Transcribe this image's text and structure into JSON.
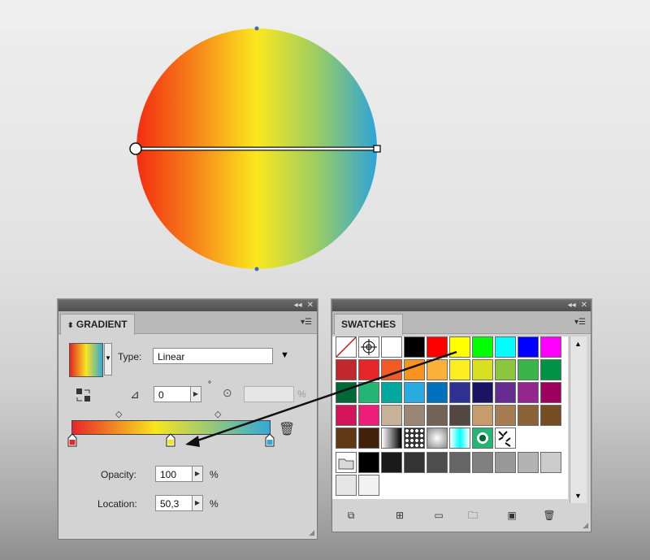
{
  "gradient_panel": {
    "title": "GRADIENT",
    "type_label": "Type:",
    "type_value": "Linear",
    "angle_value": "0",
    "degree_symbol": "°",
    "percent": "%",
    "opacity_label": "Opacity:",
    "opacity_value": "100",
    "location_label": "Location:",
    "location_value": "50,3",
    "percent_opacity": "%",
    "percent_location": "%",
    "stops": [
      {
        "color": "#e8262a",
        "location": 0
      },
      {
        "color": "#f8e51f",
        "location": 0.42
      },
      {
        "color": "#33a9d6",
        "location": 1
      }
    ]
  },
  "swatches_panel": {
    "title": "SWATCHES"
  },
  "colors": {
    "gradient_start": "#f32d10",
    "gradient_mid": "#fbe81e",
    "gradient_end": "#2ea4d9"
  }
}
